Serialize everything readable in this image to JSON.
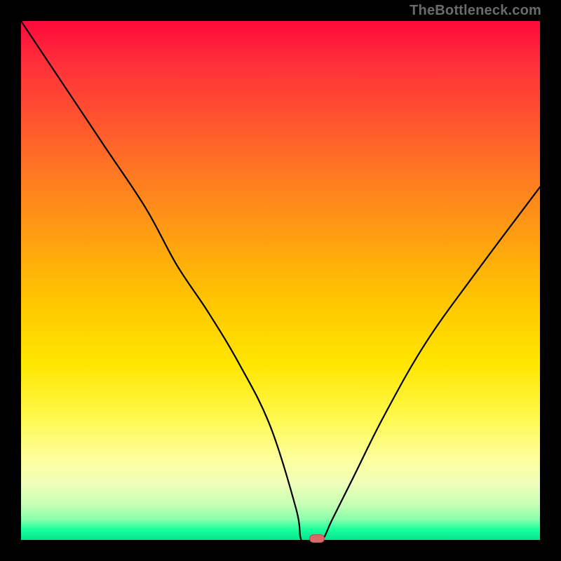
{
  "watermark": {
    "text": "TheBottleneck.com"
  },
  "chart_data": {
    "type": "line",
    "title": "",
    "xlabel": "",
    "ylabel": "",
    "xlim": [
      0,
      100
    ],
    "ylim": [
      0,
      100
    ],
    "x": [
      0,
      8,
      16,
      24,
      30,
      36,
      42,
      48,
      53,
      54,
      56,
      58,
      60,
      64,
      70,
      78,
      88,
      100
    ],
    "values": [
      100,
      88,
      76,
      64,
      53,
      44,
      34,
      22,
      6,
      0,
      0,
      0,
      4,
      12,
      24,
      38,
      52,
      68
    ],
    "marker": {
      "x": 57,
      "y": 0,
      "color": "#d96a6a"
    },
    "background_gradient": {
      "top": "#ff0a3c",
      "mid": "#ffe600",
      "bottom": "#00e68a"
    }
  }
}
